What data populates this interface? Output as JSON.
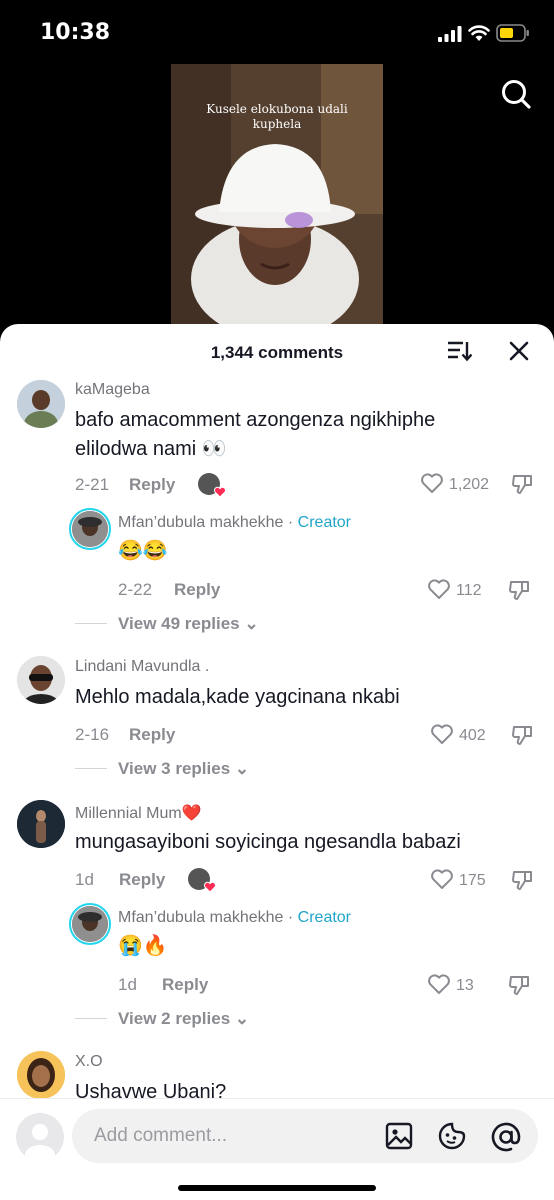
{
  "status_bar": {
    "time": "10:38"
  },
  "video": {
    "caption_line1": "Kusele elokubona udali",
    "caption_line2": "kuphela"
  },
  "header": {
    "comments_count": "1,344 comments"
  },
  "comments": [
    {
      "username": "kaMageba",
      "text_line1": "bafo amacomment azongenza ngikhiphe",
      "text_line2": "elilodwa nami 👀",
      "date": "2-21",
      "reply_label": "Reply",
      "likes": "1,202",
      "creator_reply": {
        "username": "Mfan’dubula makhekhe",
        "separator": " · ",
        "creator_label": "Creator",
        "text": "😂😂",
        "date": "2-22",
        "reply_label": "Reply",
        "likes": "112"
      },
      "view_replies": "View 49 replies"
    },
    {
      "username": "Lindani Mavundla .",
      "text_line1": "Mehlo madala,kade yagcinana nkabi",
      "date": "2-16",
      "reply_label": "Reply",
      "likes": "402",
      "view_replies": "View 3 replies"
    },
    {
      "username": "Millennial Mum❤️",
      "text_line1": "mungasayiboni soyicinga ngesandla babazi",
      "date": "1d",
      "reply_label": "Reply",
      "likes": "175",
      "creator_reply": {
        "username": "Mfan’dubula makhekhe",
        "separator": " · ",
        "creator_label": "Creator",
        "text": "😭🔥",
        "date": "1d",
        "reply_label": "Reply",
        "likes": "13"
      },
      "view_replies": "View 2 replies"
    },
    {
      "username": "X.O",
      "text_line1": "Ushavwe Ubani?"
    }
  ],
  "input": {
    "placeholder": "Add comment..."
  },
  "colors": {
    "creator_accent": "#20a5c8",
    "like_heart": "#fe2c55"
  }
}
